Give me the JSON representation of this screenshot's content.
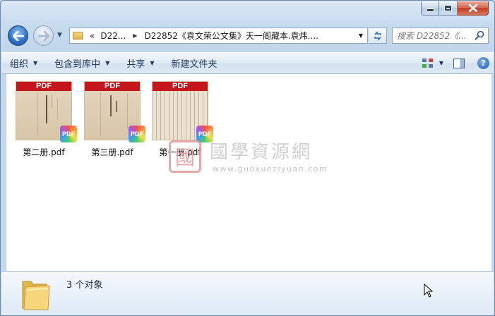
{
  "window": {
    "caption_buttons": {
      "minimize": "minimize-icon",
      "maximize": "maximize-icon",
      "close": "close-icon"
    }
  },
  "nav": {
    "address": {
      "overflow": "«",
      "parts": [
        "D22...",
        "D22852《袁文荣公文集》天一阁藏本.袁炜...."
      ]
    },
    "search_placeholder": "搜索 D22852《..."
  },
  "toolbar": {
    "organize": "组织",
    "include_library": "包含到库中",
    "share": "共享",
    "new_folder": "新建文件夹"
  },
  "files": [
    {
      "name": "第二册.pdf",
      "thumb_label": "PDF",
      "badge": "PDF"
    },
    {
      "name": "第三册.pdf",
      "thumb_label": "PDF",
      "badge": "PDF"
    },
    {
      "name": "第一册.pdf",
      "thumb_label": "PDF",
      "badge": "PDF"
    }
  ],
  "watermark": {
    "seal": "國",
    "title": "國學資源網",
    "url": "www.guoxueziyuan.com"
  },
  "status": {
    "count_text": "3 个对象"
  },
  "colors": {
    "pdf_red": "#c4161c",
    "window_chrome": "#c7dbef",
    "close_red": "#c23a1e"
  }
}
